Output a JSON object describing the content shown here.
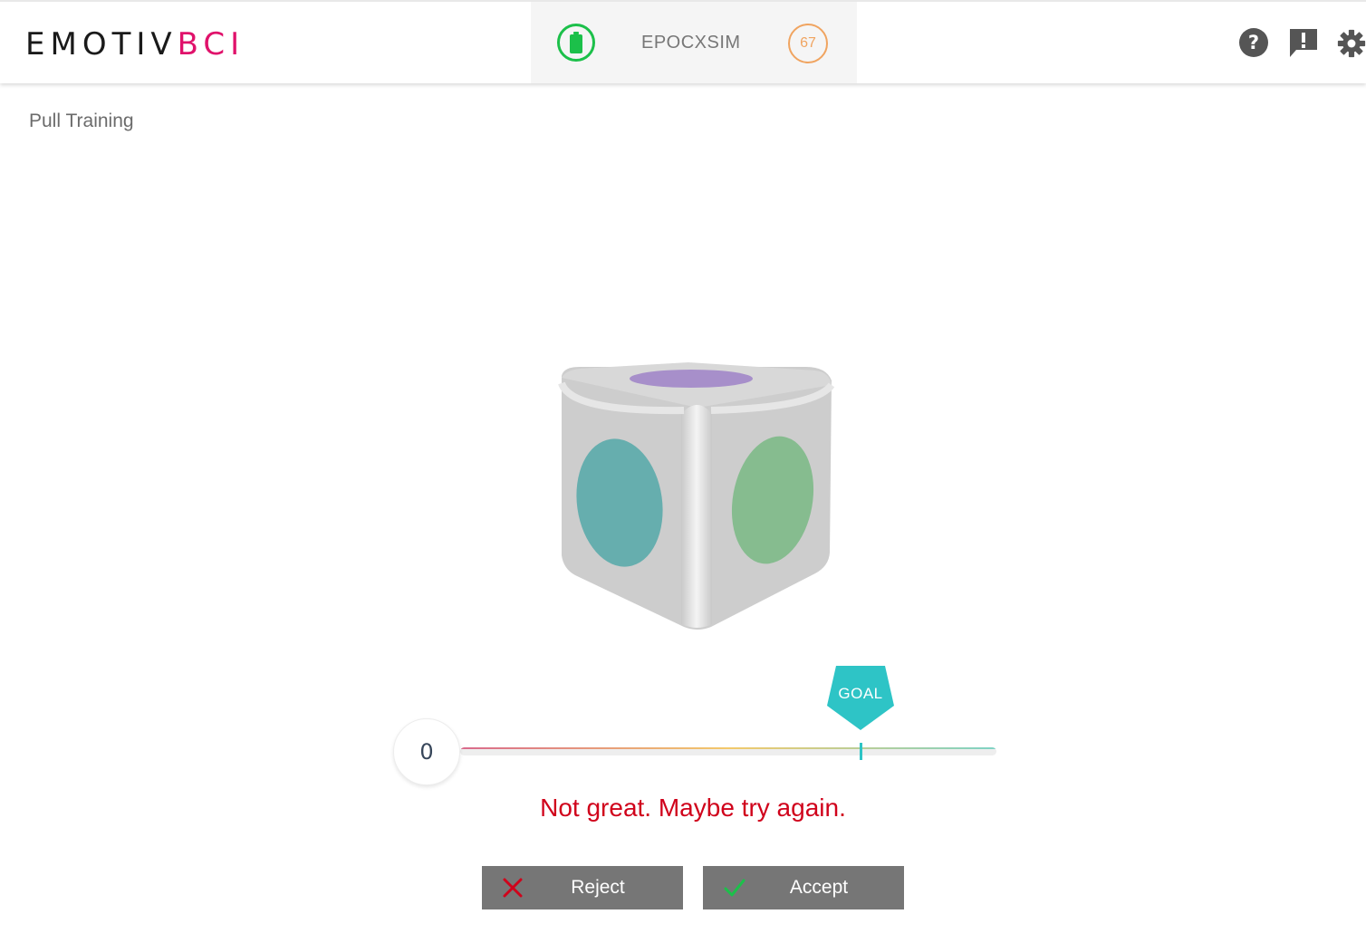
{
  "header": {
    "logo": {
      "part1": "EMOTIV",
      "part2": "BCI"
    },
    "device": {
      "name": "EPOCXSIM",
      "signal": "67"
    },
    "icons": [
      "help-icon",
      "feedback-icon",
      "settings-icon"
    ]
  },
  "page": {
    "title": "Pull Training"
  },
  "training": {
    "score": "0",
    "score_fraction": 0.0,
    "goal_label": "GOAL",
    "goal_fraction": 0.75,
    "feedback": "Not great. Maybe try again."
  },
  "actions": {
    "reject_label": "Reject",
    "accept_label": "Accept"
  },
  "colors": {
    "brand_pink": "#e0126b",
    "battery_green": "#1cc04a",
    "signal_orange": "#f0a460",
    "goal_teal": "#2ec4c6",
    "feedback_red": "#d0021b",
    "button_grey": "#767676"
  }
}
